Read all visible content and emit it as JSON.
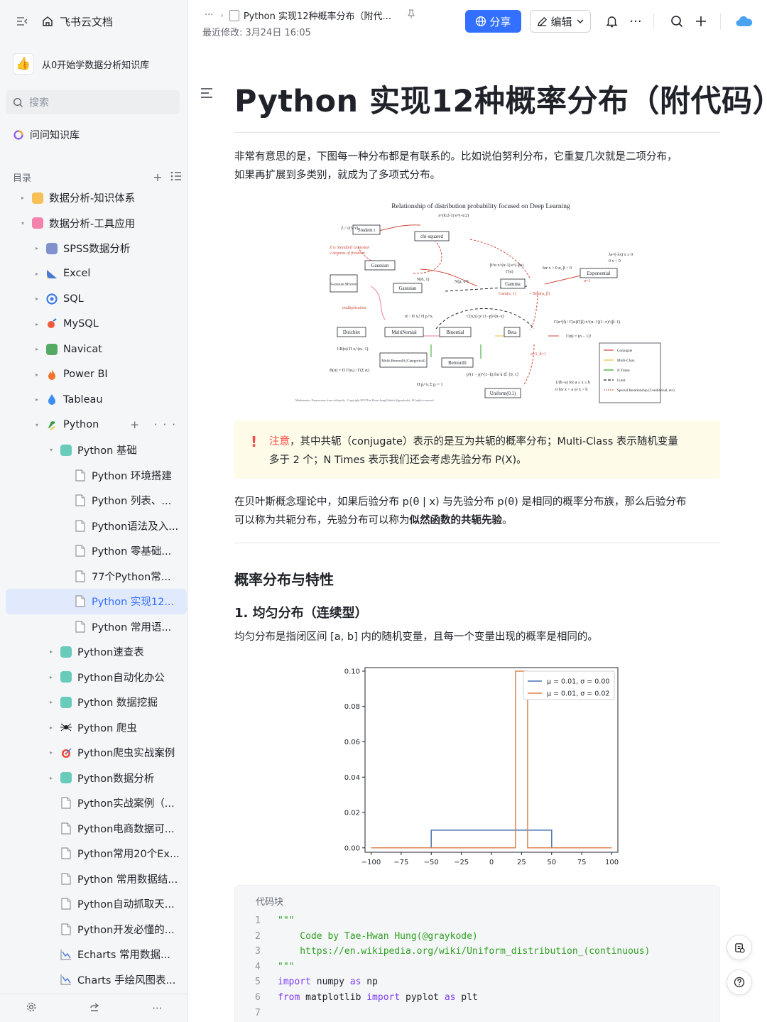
{
  "sidebar": {
    "brand": "飞书云文档",
    "knowledge_base": "从0开始学数据分析知识库",
    "search_placeholder": "搜索",
    "ask": "问问知识库",
    "toc_label": "目录",
    "tree": [
      {
        "label": "数据分析-知识体系",
        "level": 1,
        "arrow": "▸",
        "icon": "folder-orange-icon",
        "color": "#f7b53b"
      },
      {
        "label": "数据分析-工具应用",
        "level": 1,
        "arrow": "▾",
        "icon": "folder-pink-icon",
        "color": "#f26ea0"
      },
      {
        "label": "SPSS数据分析",
        "level": 2,
        "arrow": "▸",
        "icon": "spss-icon",
        "color": "#6b7fc7"
      },
      {
        "label": "Excel",
        "level": 2,
        "arrow": "▸",
        "icon": "chart-icon",
        "color": "#4a78d6"
      },
      {
        "label": "SQL",
        "level": 2,
        "arrow": "▸",
        "icon": "sql-swirl-icon",
        "color": "#3c7be8"
      },
      {
        "label": "MySQL",
        "level": 2,
        "arrow": "▸",
        "icon": "mysql-icon",
        "color": "#ee5a3a"
      },
      {
        "label": "Navicat",
        "level": 2,
        "arrow": "▸",
        "icon": "navicat-icon",
        "color": "#3a9e4a"
      },
      {
        "label": "Power BI",
        "level": 2,
        "arrow": "▸",
        "icon": "fire-icon",
        "color": "#f0742c"
      },
      {
        "label": "Tableau",
        "level": 2,
        "arrow": "▸",
        "icon": "drop-icon",
        "color": "#3d8ef0"
      },
      {
        "label": "Python",
        "level": 2,
        "arrow": "▾",
        "icon": "python-icon",
        "color": "#3d9b4b",
        "tools": true
      },
      {
        "label": "Python 基础",
        "level": 3,
        "arrow": "▾",
        "icon": "teal-folder-icon",
        "color": "#4fc3b0"
      },
      {
        "label": "Python 环境搭建",
        "level": 4,
        "arrow": "",
        "icon": "doc-icon",
        "color": "#8f959e"
      },
      {
        "label": "Python 列表、...",
        "level": 4,
        "arrow": "",
        "icon": "doc-icon",
        "color": "#8f959e"
      },
      {
        "label": "Python语法及入...",
        "level": 4,
        "arrow": "",
        "icon": "doc-icon",
        "color": "#8f959e"
      },
      {
        "label": "Python 零基础...",
        "level": 4,
        "arrow": "",
        "icon": "doc-icon",
        "color": "#8f959e"
      },
      {
        "label": "77个Python常...",
        "level": 4,
        "arrow": "",
        "icon": "doc-icon",
        "color": "#8f959e"
      },
      {
        "label": "Python 实现12...",
        "level": 4,
        "arrow": "",
        "icon": "doc-icon",
        "color": "#8f959e",
        "active": true
      },
      {
        "label": "Python 常用语...",
        "level": 4,
        "arrow": "",
        "icon": "doc-icon",
        "color": "#8f959e"
      },
      {
        "label": "Python速查表",
        "level": 3,
        "arrow": "▸",
        "icon": "teal-folder-icon",
        "color": "#4fc3b0"
      },
      {
        "label": "Python自动化办公",
        "level": 3,
        "arrow": "▸",
        "icon": "teal-folder-icon",
        "color": "#4fc3b0"
      },
      {
        "label": "Python 数据挖掘",
        "level": 3,
        "arrow": "▸",
        "icon": "teal-folder-icon",
        "color": "#4fc3b0"
      },
      {
        "label": "Python 爬虫",
        "level": 3,
        "arrow": "▸",
        "icon": "spider-icon",
        "color": "#1f2329"
      },
      {
        "label": "Python爬虫实战案例",
        "level": 3,
        "arrow": "▸",
        "icon": "target-icon",
        "color": "#e8483a"
      },
      {
        "label": "Python数据分析",
        "level": 3,
        "arrow": "▸",
        "icon": "teal-folder-icon",
        "color": "#4fc3b0"
      },
      {
        "label": "Python实战案例（...",
        "level": 3,
        "arrow": "",
        "icon": "doc-icon",
        "color": "#8f959e"
      },
      {
        "label": "Python电商数据可...",
        "level": 3,
        "arrow": "",
        "icon": "doc-icon",
        "color": "#8f959e"
      },
      {
        "label": "Python常用20个Ex...",
        "level": 3,
        "arrow": "",
        "icon": "doc-icon",
        "color": "#8f959e"
      },
      {
        "label": "Python 常用数据结...",
        "level": 3,
        "arrow": "",
        "icon": "doc-icon",
        "color": "#8f959e"
      },
      {
        "label": "Python自动抓取天...",
        "level": 3,
        "arrow": "",
        "icon": "doc-icon",
        "color": "#8f959e"
      },
      {
        "label": "Python开发必懂的...",
        "level": 3,
        "arrow": "",
        "icon": "doc-icon",
        "color": "#8f959e"
      },
      {
        "label": "Echarts 常用数据...",
        "level": 3,
        "arrow": "",
        "icon": "line-chart-icon",
        "color": "#4a78d6"
      },
      {
        "label": "Charts 手绘风图表...",
        "level": 3,
        "arrow": "",
        "icon": "line-chart-icon",
        "color": "#4a78d6"
      }
    ]
  },
  "header": {
    "breadcrumb_title": "Python 实现12种概率分布（附代...",
    "last_modified": "最近修改: 3月24日 16:05",
    "share_label": "分享",
    "edit_label": "编辑"
  },
  "content": {
    "title": "Python 实现12种概率分布（附代码）",
    "intro_line1": "非常有意思的是，下图每一种分布都是有联系的。比如说伯努利分布，它重复几次就是二项分布，",
    "intro_line2": "如果再扩展到多类别，就成为了多项式分布。",
    "figure_title": "Relationship of distribution probability focused on Deep Learning",
    "figure_nodes": [
      "Student t",
      "chi-squared",
      "Gaussian",
      "Gaussian Mixture",
      "Gaussian",
      "Gamma",
      "Exponential",
      "Dirichlet",
      "MultiNomial",
      "Binomial",
      "Beta",
      "Multi-Bernoulli (Categorical)",
      "Bernoulli",
      "Uniform(0,1)"
    ],
    "figure_legend": [
      "Conjugate",
      "Multi-Class",
      "N Times",
      "Limit",
      "Special Relationship (Conditional, etc)"
    ],
    "figure_credit": "Mathematics Expressions from wikipedia · Copyright 2019 Tae Hwan Jung(Github @graykode). All rights reserved.",
    "callout_warn": "注意",
    "callout_line1": "，其中共轭（conjugate）表示的是互为共轭的概率分布；Multi-Class 表示随机变量",
    "callout_line2": "多于 2 个；N Times 表示我们还会考虑先验分布 P(X)。",
    "bayes_line1": "在贝叶斯概念理论中，如果后验分布 p(θ | x) 与先验分布 p(θ) 是相同的概率分布族，那么后验分布",
    "bayes_line2_a": "可以称为共轭分布，先验分布可以称为",
    "bayes_line2_b": "似然函数的共轭先验",
    "bayes_line2_c": "。",
    "section_heading": "概率分布与特性",
    "sub_heading": "1. 均匀分布（连续型）",
    "uniform_desc": "均匀分布是指闭区间 [a, b] 内的随机变量，且每一个变量出现的概率是相同的。",
    "code_block_title": "代码块",
    "code_lines": [
      {
        "n": "1",
        "text": "\"\"\"",
        "cls": "str"
      },
      {
        "n": "2",
        "text": "    Code by Tae-Hwan Hung(@graykode)",
        "cls": "str"
      },
      {
        "n": "3",
        "text": "    https://en.wikipedia.org/wiki/Uniform_distribution_(continuous)",
        "cls": "str"
      },
      {
        "n": "4",
        "text": "\"\"\"",
        "cls": "str"
      },
      {
        "n": "5",
        "kw1": "import",
        "mid": " numpy ",
        "kw2": "as",
        "tail": " np"
      },
      {
        "n": "6",
        "kw1": "from",
        "mid": " matplotlib ",
        "kw2": "import",
        "tail": " pyplot ",
        "kw3": "as",
        "tail2": " plt"
      },
      {
        "n": "7",
        "text": ""
      }
    ]
  },
  "chart_data": {
    "type": "line",
    "series": [
      {
        "name": "μ = 0.01, σ = 0.00",
        "color": "#4c72b0",
        "x": [
          -100,
          -50,
          -50,
          50,
          50,
          100
        ],
        "y": [
          0,
          0,
          0.01,
          0.01,
          0,
          0
        ]
      },
      {
        "name": "μ = 0.01, σ = 0.02",
        "color": "#dd8452",
        "x": [
          -100,
          20,
          20,
          30,
          30,
          100
        ],
        "y": [
          0,
          0,
          0.1,
          0.1,
          0,
          0
        ]
      }
    ],
    "xticks": [
      "−100",
      "−75",
      "−50",
      "−25",
      "0",
      "25",
      "50",
      "75",
      "100"
    ],
    "yticks": [
      "0.00",
      "0.02",
      "0.04",
      "0.06",
      "0.08",
      "0.10"
    ],
    "xlim": [
      -105,
      105
    ],
    "ylim": [
      -0.0025,
      0.102
    ],
    "legend": "top-right",
    "grid": false
  },
  "colors": {
    "accent": "#3370ff",
    "warn": "#f54a45",
    "callout_bg": "#fefbe8"
  }
}
